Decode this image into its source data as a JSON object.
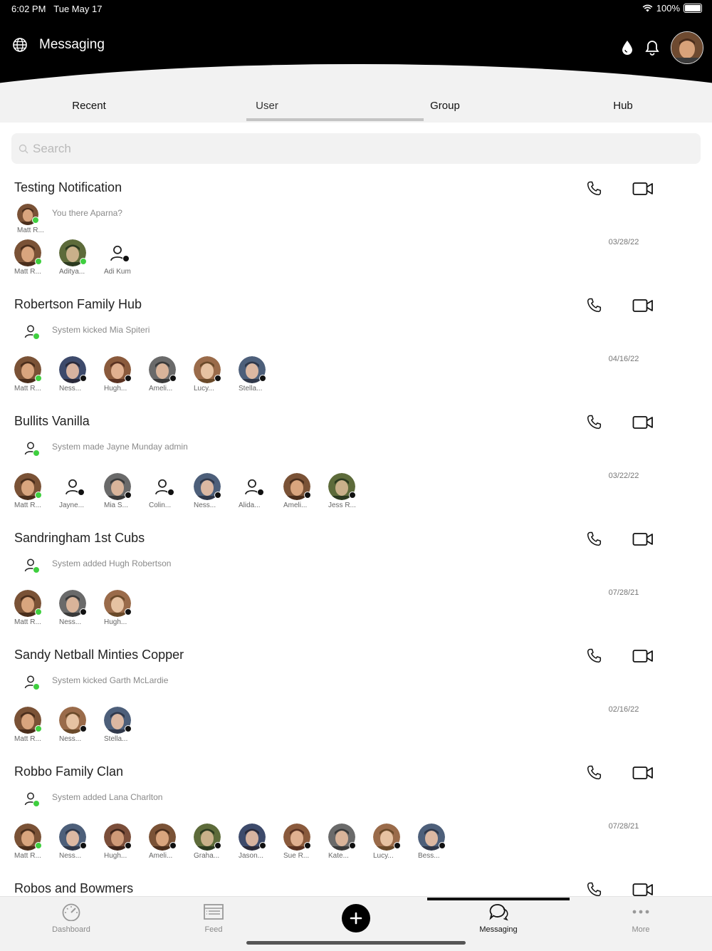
{
  "status_bar": {
    "time": "6:02 PM",
    "date": "Tue May 17",
    "battery": "100%"
  },
  "header": {
    "title": "Messaging"
  },
  "tabs": [
    {
      "label": "Recent"
    },
    {
      "label": "User"
    },
    {
      "label": "Group"
    },
    {
      "label": "Hub"
    }
  ],
  "active_tab": "User",
  "search": {
    "placeholder": "Search",
    "value": ""
  },
  "conversations": [
    {
      "title": "Testing Notification",
      "last_sender": {
        "name": "Matt R...",
        "photo": true
      },
      "last_message": "You there Aparna?",
      "date": "03/28/22",
      "members": [
        {
          "name": "Matt R...",
          "photo": true,
          "status": "online"
        },
        {
          "name": "Aditya...",
          "photo": true,
          "status": "online"
        },
        {
          "name": "Adi Kum",
          "photo": false,
          "status": "offline"
        }
      ]
    },
    {
      "title": "Robertson Family Hub",
      "last_message": "System kicked Mia Spiteri",
      "date": "04/16/22",
      "members": [
        {
          "name": "Matt R...",
          "photo": true,
          "status": "online"
        },
        {
          "name": "Ness...",
          "photo": true,
          "status": "offline"
        },
        {
          "name": "Hugh...",
          "photo": true,
          "status": "offline"
        },
        {
          "name": "Ameli...",
          "photo": true,
          "status": "offline"
        },
        {
          "name": "Lucy...",
          "photo": true,
          "status": "offline"
        },
        {
          "name": "Stella...",
          "photo": true,
          "status": "offline"
        }
      ]
    },
    {
      "title": "Bullits Vanilla",
      "last_message": "System made Jayne Munday admin",
      "date": "03/22/22",
      "members": [
        {
          "name": "Matt R...",
          "photo": true,
          "status": "online"
        },
        {
          "name": "Jayne...",
          "photo": false,
          "status": "offline"
        },
        {
          "name": "Mia S...",
          "photo": true,
          "status": "offline"
        },
        {
          "name": "Colin...",
          "photo": false,
          "status": "offline"
        },
        {
          "name": "Ness...",
          "photo": true,
          "status": "offline"
        },
        {
          "name": "Alida...",
          "photo": false,
          "status": "offline"
        },
        {
          "name": "Ameli...",
          "photo": true,
          "status": "offline"
        },
        {
          "name": "Jess R...",
          "photo": true,
          "status": "offline"
        }
      ]
    },
    {
      "title": "Sandringham 1st Cubs",
      "last_message": "System added Hugh Robertson",
      "date": "07/28/21",
      "members": [
        {
          "name": "Matt R...",
          "photo": true,
          "status": "online"
        },
        {
          "name": "Ness...",
          "photo": true,
          "status": "offline"
        },
        {
          "name": "Hugh...",
          "photo": true,
          "status": "offline"
        }
      ]
    },
    {
      "title": "Sandy Netball Minties Copper",
      "last_message": "System kicked Garth McLardie",
      "date": "02/16/22",
      "members": [
        {
          "name": "Matt R...",
          "photo": true,
          "status": "online"
        },
        {
          "name": "Ness...",
          "photo": true,
          "status": "offline"
        },
        {
          "name": "Stella...",
          "photo": true,
          "status": "offline"
        }
      ]
    },
    {
      "title": "Robbo Family Clan",
      "last_message": "System added Lana Charlton",
      "date": "07/28/21",
      "members": [
        {
          "name": "Matt R...",
          "photo": true,
          "status": "online"
        },
        {
          "name": "Ness...",
          "photo": true,
          "status": "offline"
        },
        {
          "name": "Hugh...",
          "photo": true,
          "status": "offline"
        },
        {
          "name": "Ameli...",
          "photo": true,
          "status": "offline"
        },
        {
          "name": "Graha...",
          "photo": true,
          "status": "offline"
        },
        {
          "name": "Jason...",
          "photo": true,
          "status": "offline"
        },
        {
          "name": "Sue R...",
          "photo": true,
          "status": "offline"
        },
        {
          "name": "Kate...",
          "photo": true,
          "status": "offline"
        },
        {
          "name": "Lucy...",
          "photo": true,
          "status": "offline"
        },
        {
          "name": "Bess...",
          "photo": true,
          "status": "offline"
        }
      ]
    },
    {
      "title": "Robos and Bowmers",
      "last_message": "",
      "date": "",
      "members": []
    }
  ],
  "bottom_nav": [
    {
      "label": "Dashboard",
      "icon": "gauge-icon"
    },
    {
      "label": "Feed",
      "icon": "feed-icon"
    },
    {
      "label": "",
      "icon": "plus-icon"
    },
    {
      "label": "Messaging",
      "icon": "chat-bubbles-icon"
    },
    {
      "label": "More",
      "icon": "more-dots-icon"
    }
  ],
  "active_nav": "Messaging",
  "colors": {
    "online": "#3fcf3f",
    "offline": "#111111",
    "header": "#000000",
    "panel": "#f2f2f2"
  }
}
